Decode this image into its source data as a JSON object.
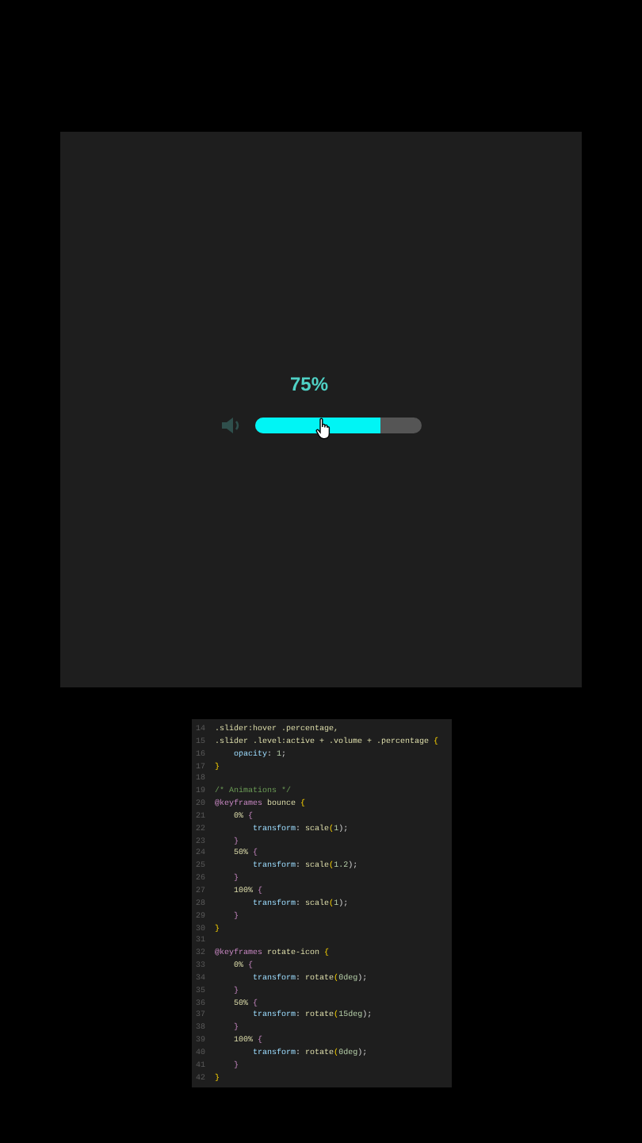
{
  "player": {
    "percentage": "75%",
    "volume": {
      "level": 0.75
    }
  },
  "code_editor": {
    "lines": [
      {
        "number": "14",
        "tokens": [
          {
            "t": ".slider:hover .percentage,",
            "kind": "sel"
          }
        ]
      },
      {
        "number": "15",
        "tokens": [
          {
            "t": ".slider .level:active + .volume + .percentage",
            "kind": "sel"
          },
          {
            "t": " {",
            "kind": "punct"
          }
        ]
      },
      {
        "number": "16",
        "tokens": [
          {
            "t": "    opacity",
            "kind": "prop"
          },
          {
            "t": ": ",
            "kind": "plain"
          },
          {
            "t": "1",
            "kind": "num"
          },
          {
            "t": ";",
            "kind": "plain"
          }
        ]
      },
      {
        "number": "17",
        "tokens": [
          {
            "t": "}",
            "kind": "punct"
          }
        ]
      },
      {
        "number": "18"
      },
      {
        "number": "19",
        "tokens": [
          {
            "t": "/* Animations */",
            "kind": "comment"
          }
        ]
      },
      {
        "number": "20",
        "tokens": [
          {
            "t": "@keyframes",
            "kind": "kw"
          },
          {
            "t": " bounce ",
            "kind": "sel"
          },
          {
            "t": "{",
            "kind": "punct"
          }
        ]
      },
      {
        "number": "21",
        "tokens": [
          {
            "t": "    0%",
            "kind": "sel"
          },
          {
            "t": " {",
            "kind": "kw"
          }
        ]
      },
      {
        "number": "22",
        "tokens": [
          {
            "t": "        transform",
            "kind": "prop"
          },
          {
            "t": ": ",
            "kind": "plain"
          },
          {
            "t": "scale",
            "kind": "sel"
          },
          {
            "t": "(",
            "kind": "punct"
          },
          {
            "t": "1",
            "kind": "num"
          },
          {
            "t": ");",
            "kind": "plain"
          }
        ]
      },
      {
        "number": "23",
        "tokens": [
          {
            "t": "    }",
            "kind": "kw"
          }
        ]
      },
      {
        "number": "24",
        "tokens": [
          {
            "t": "    50%",
            "kind": "sel"
          },
          {
            "t": " {",
            "kind": "kw"
          }
        ]
      },
      {
        "number": "25",
        "tokens": [
          {
            "t": "        transform",
            "kind": "prop"
          },
          {
            "t": ": ",
            "kind": "plain"
          },
          {
            "t": "scale",
            "kind": "sel"
          },
          {
            "t": "(",
            "kind": "punct"
          },
          {
            "t": "1.2",
            "kind": "num"
          },
          {
            "t": ");",
            "kind": "plain"
          }
        ]
      },
      {
        "number": "26",
        "tokens": [
          {
            "t": "    }",
            "kind": "kw"
          }
        ]
      },
      {
        "number": "27",
        "tokens": [
          {
            "t": "    100%",
            "kind": "sel"
          },
          {
            "t": " {",
            "kind": "kw"
          }
        ]
      },
      {
        "number": "28",
        "tokens": [
          {
            "t": "        transform",
            "kind": "prop"
          },
          {
            "t": ": ",
            "kind": "plain"
          },
          {
            "t": "scale",
            "kind": "sel"
          },
          {
            "t": "(",
            "kind": "punct"
          },
          {
            "t": "1",
            "kind": "num"
          },
          {
            "t": ");",
            "kind": "plain"
          }
        ]
      },
      {
        "number": "29",
        "tokens": [
          {
            "t": "    }",
            "kind": "kw"
          }
        ]
      },
      {
        "number": "30",
        "tokens": [
          {
            "t": "}",
            "kind": "punct"
          }
        ]
      },
      {
        "number": "31"
      },
      {
        "number": "32",
        "tokens": [
          {
            "t": "@keyframes",
            "kind": "kw"
          },
          {
            "t": " rotate-icon ",
            "kind": "sel"
          },
          {
            "t": "{",
            "kind": "punct"
          }
        ]
      },
      {
        "number": "33",
        "tokens": [
          {
            "t": "    0%",
            "kind": "sel"
          },
          {
            "t": " {",
            "kind": "kw"
          }
        ]
      },
      {
        "number": "34",
        "tokens": [
          {
            "t": "        transform",
            "kind": "prop"
          },
          {
            "t": ": ",
            "kind": "plain"
          },
          {
            "t": "rotate",
            "kind": "sel"
          },
          {
            "t": "(",
            "kind": "punct"
          },
          {
            "t": "0deg",
            "kind": "num"
          },
          {
            "t": ");",
            "kind": "plain"
          }
        ]
      },
      {
        "number": "35",
        "tokens": [
          {
            "t": "    }",
            "kind": "kw"
          }
        ]
      },
      {
        "number": "36",
        "tokens": [
          {
            "t": "    50%",
            "kind": "sel"
          },
          {
            "t": " {",
            "kind": "kw"
          }
        ]
      },
      {
        "number": "37",
        "tokens": [
          {
            "t": "        transform",
            "kind": "prop"
          },
          {
            "t": ": ",
            "kind": "plain"
          },
          {
            "t": "rotate",
            "kind": "sel"
          },
          {
            "t": "(",
            "kind": "punct"
          },
          {
            "t": "15deg",
            "kind": "num"
          },
          {
            "t": ");",
            "kind": "plain"
          }
        ]
      },
      {
        "number": "38",
        "tokens": [
          {
            "t": "    }",
            "kind": "kw"
          }
        ]
      },
      {
        "number": "39",
        "tokens": [
          {
            "t": "    100%",
            "kind": "sel"
          },
          {
            "t": " {",
            "kind": "kw"
          }
        ]
      },
      {
        "number": "40",
        "tokens": [
          {
            "t": "        transform",
            "kind": "prop"
          },
          {
            "t": ": ",
            "kind": "plain"
          },
          {
            "t": "rotate",
            "kind": "sel"
          },
          {
            "t": "(",
            "kind": "punct"
          },
          {
            "t": "0deg",
            "kind": "num"
          },
          {
            "t": ");",
            "kind": "plain"
          }
        ]
      },
      {
        "number": "41",
        "tokens": [
          {
            "t": "    }",
            "kind": "kw"
          }
        ]
      },
      {
        "number": "42",
        "tokens": [
          {
            "t": "}",
            "kind": "punct"
          }
        ]
      }
    ]
  }
}
